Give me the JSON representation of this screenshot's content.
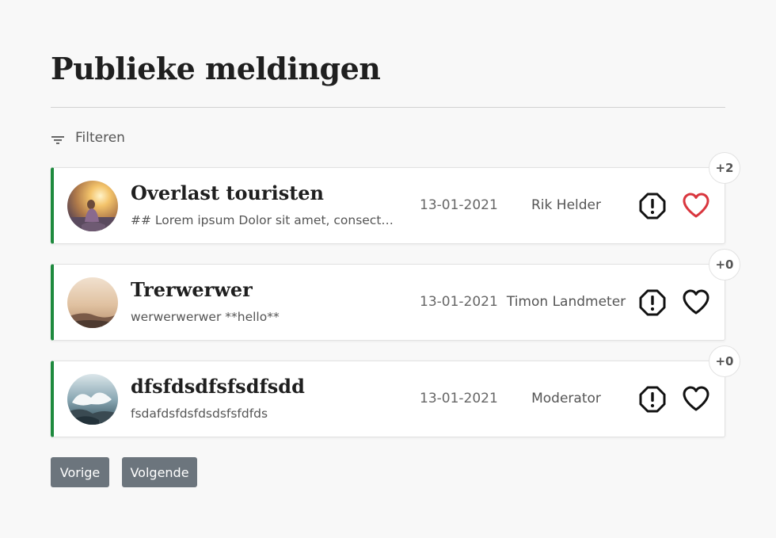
{
  "page": {
    "title": "Publieke meldingen",
    "filter_label": "Filteren"
  },
  "colors": {
    "accent_border": "#1e8a3e",
    "liked_heart": "#d9363e",
    "button": "#6c757d"
  },
  "reports": [
    {
      "title": "Overlast touristen",
      "description": "## Lorem ipsum Dolor sit amet, consectetur adipiscing elit",
      "date": "13-01-2021",
      "user": "Rik Helder",
      "likes": "+2",
      "liked": true,
      "avatar": "sunset-person-photo"
    },
    {
      "title": "Trerwerwer",
      "description": "werwerwerwer **hello**",
      "date": "13-01-2021",
      "user": "Timon Landmeter",
      "likes": "+0",
      "liked": false,
      "avatar": "misty-landscape-photo"
    },
    {
      "title": "dfsfdsdfsfsdfsdd",
      "description": "fsdafdsfdsfdsdsfsfdfds",
      "date": "13-01-2021",
      "user": "Moderator",
      "likes": "+0",
      "liked": false,
      "avatar": "ocean-waves-photo"
    }
  ],
  "pagination": {
    "prev_label": "Vorige",
    "next_label": "Volgende"
  },
  "icons": {
    "filter": "filter-icon",
    "report": "report-octagon-icon",
    "like": "heart-icon"
  }
}
